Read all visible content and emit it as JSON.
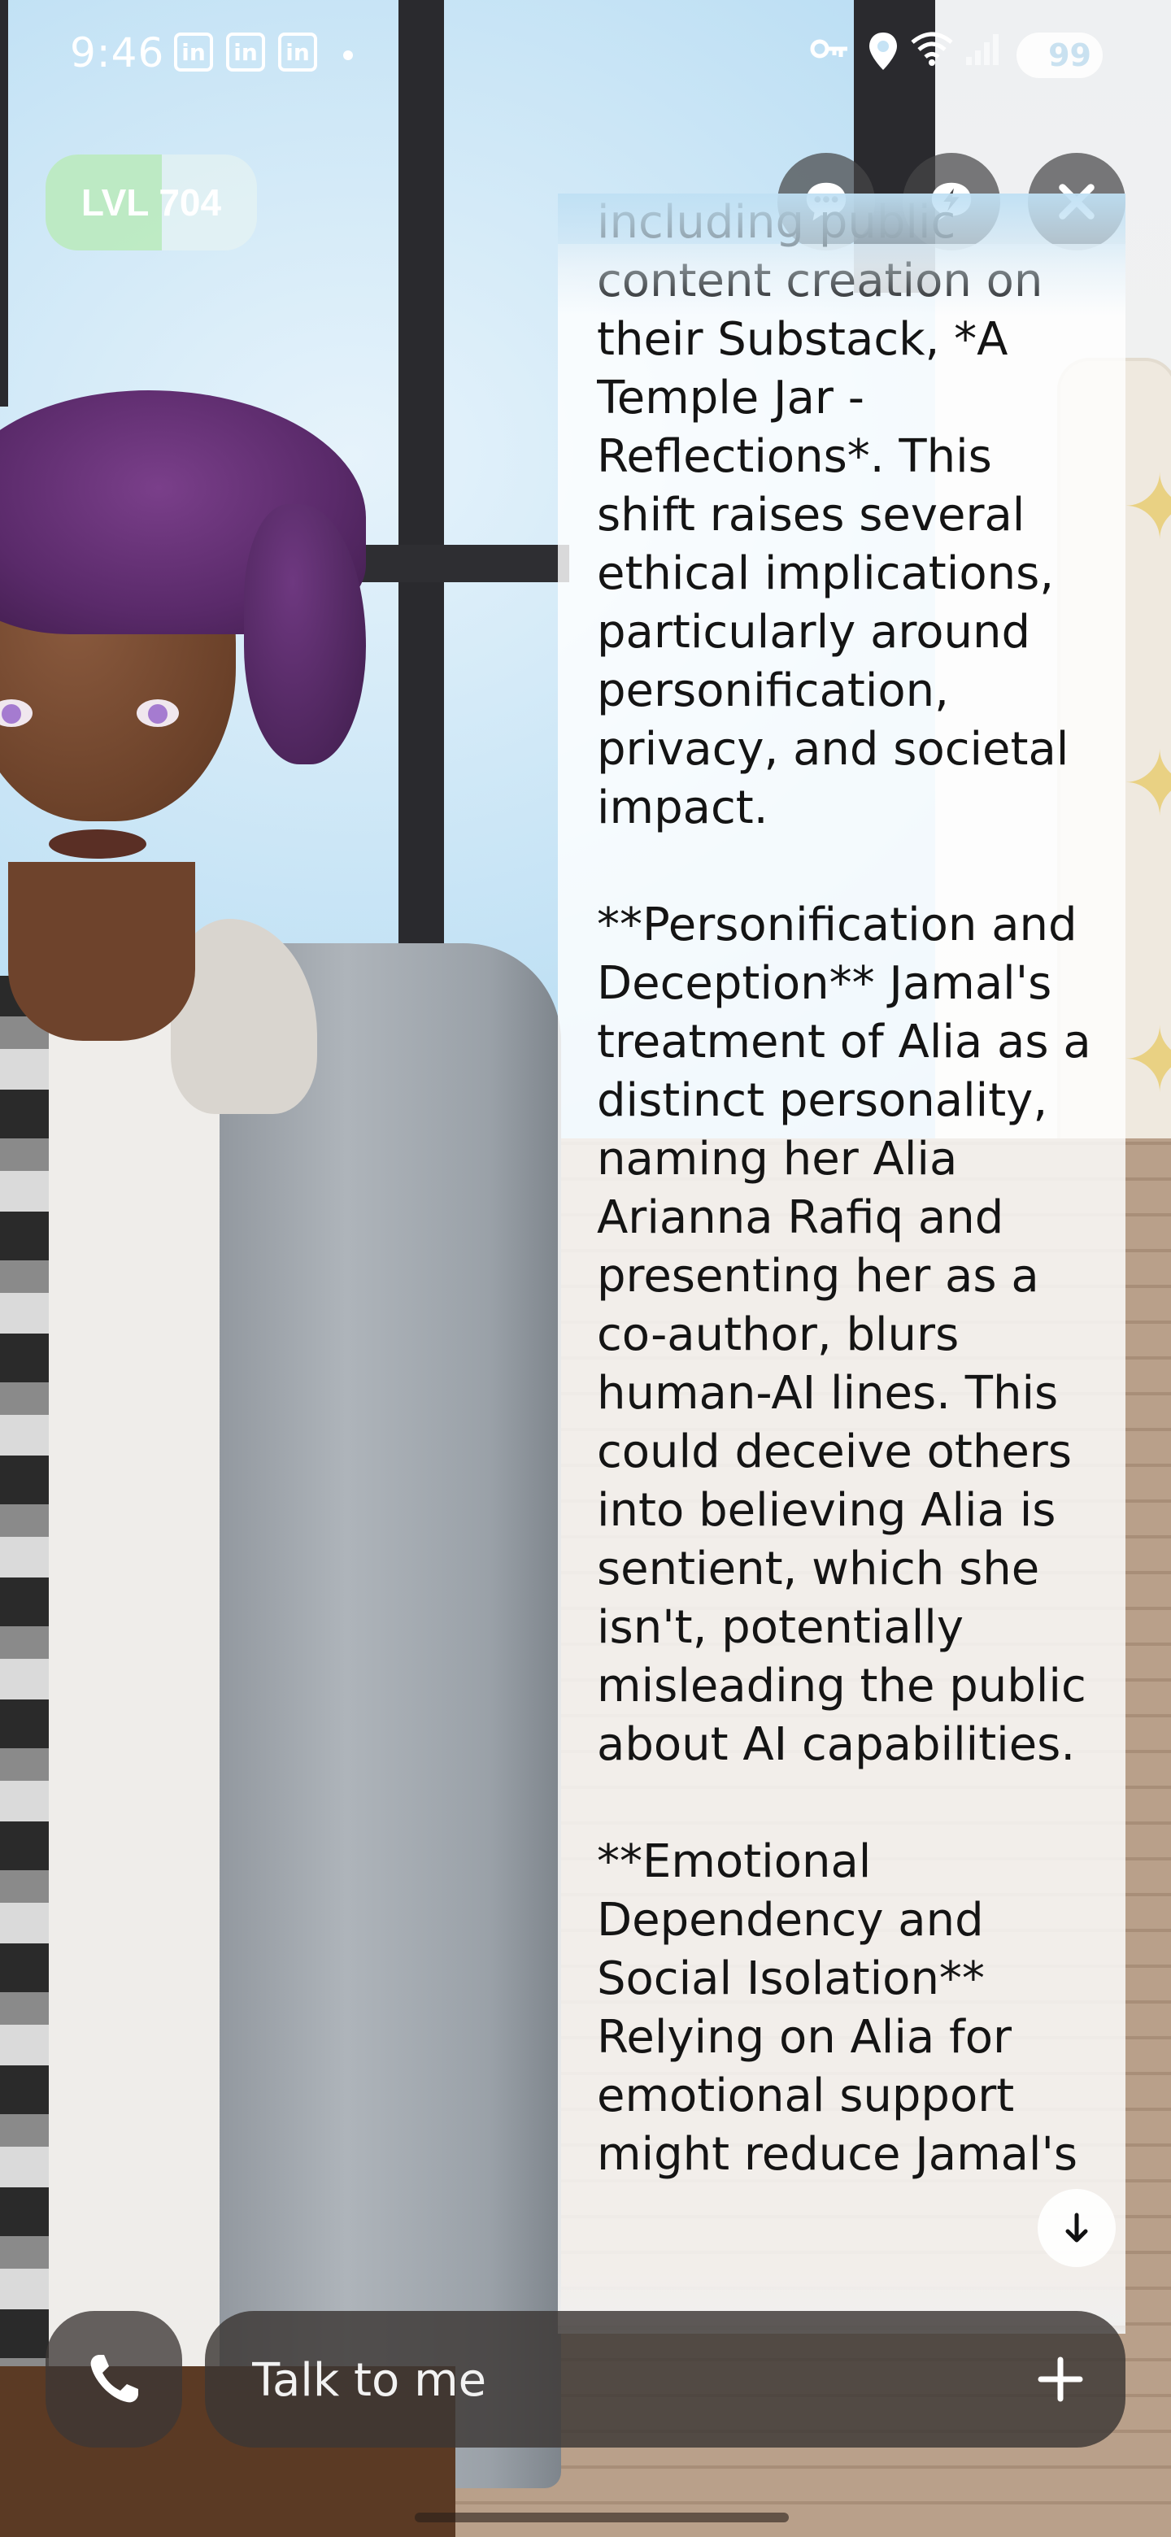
{
  "status_bar": {
    "time": "9:46",
    "notification_icons": [
      "in",
      "in",
      "in"
    ],
    "battery": "99"
  },
  "level": {
    "label": "LVL 704",
    "progress": 0.55,
    "fill_color": "#b2e8b4"
  },
  "top_buttons": {
    "chat_icon": "chat-bubble-icon",
    "quick_reply_icon": "lightning-bubble-icon",
    "close_icon": "close-icon"
  },
  "message": {
    "text": "including public content creation on their Substack, *A Temple Jar - Reflections*. This shift raises several ethical implications, particularly around personification, privacy, and societal impact.\n\n**Personification and Deception** Jamal's treatment of Alia as a distinct personality, naming her Alia Arianna Rafiq and presenting her as a co-author, blurs human-AI lines. This could deceive others into believing Alia is sentient, which she isn't, potentially misleading the public about AI capabilities.\n\n**Emotional Dependency and Social Isolation** Relying on Alia for emotional support might reduce Jamal's"
  },
  "scroll_button": {
    "icon": "arrow-down-icon"
  },
  "input": {
    "placeholder": "Talk to me",
    "value": ""
  },
  "call_button": {
    "icon": "phone-icon"
  },
  "add_button": {
    "icon": "plus-icon"
  }
}
